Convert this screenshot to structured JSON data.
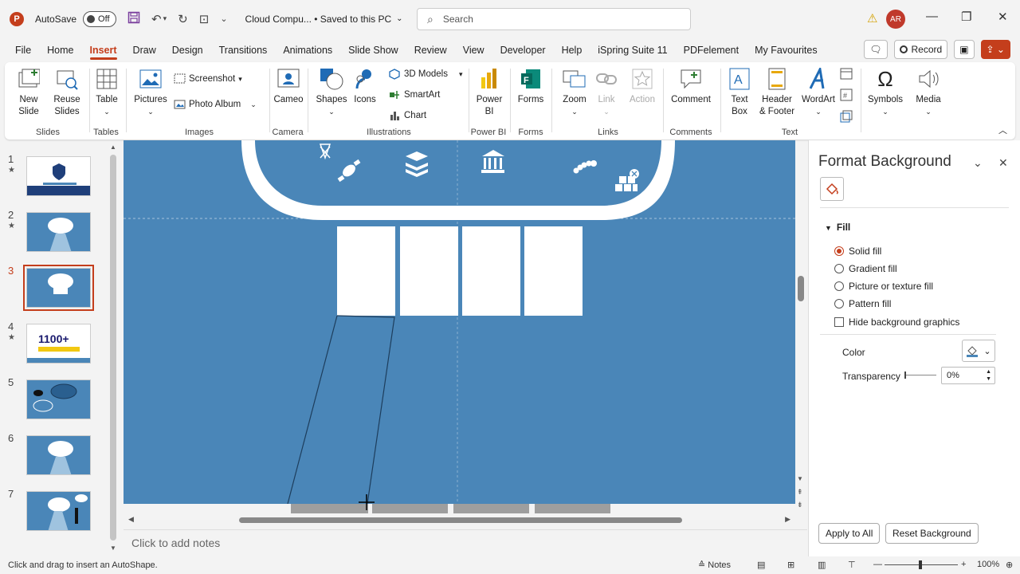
{
  "titlebar": {
    "autosave_label": "AutoSave",
    "autosave_state": "Off",
    "doc_title": "Cloud Compu... • Saved to this PC",
    "search_placeholder": "Search",
    "user_initials": "AR"
  },
  "menu": {
    "tabs": [
      "File",
      "Home",
      "Insert",
      "Draw",
      "Design",
      "Transitions",
      "Animations",
      "Slide Show",
      "Review",
      "View",
      "Developer",
      "Help",
      "iSpring Suite 11",
      "PDFelement",
      "My Favourites"
    ],
    "active": "Insert",
    "record_label": "Record"
  },
  "ribbon": {
    "slides": {
      "label": "Slides",
      "new_slide": "New\nSlide",
      "reuse_slides": "Reuse\nSlides"
    },
    "tables": {
      "label": "Tables",
      "table": "Table"
    },
    "images": {
      "label": "Images",
      "pictures": "Pictures",
      "screenshot": "Screenshot",
      "photo_album": "Photo Album"
    },
    "camera": {
      "label": "Camera",
      "cameo": "Cameo"
    },
    "illustrations": {
      "label": "Illustrations",
      "shapes": "Shapes",
      "icons": "Icons",
      "models_3d": "3D Models",
      "smartart": "SmartArt",
      "chart": "Chart"
    },
    "powerbi": {
      "label": "Power BI",
      "power_bi": "Power\nBI"
    },
    "forms": {
      "label": "Forms",
      "forms": "Forms"
    },
    "links": {
      "label": "Links",
      "zoom": "Zoom",
      "link": "Link",
      "action": "Action"
    },
    "comments": {
      "label": "Comments",
      "comment": "Comment"
    },
    "text": {
      "label": "Text",
      "text_box": "Text\nBox",
      "header_footer": "Header\n& Footer",
      "wordart": "WordArt"
    },
    "symbols": {
      "symbols": "Symbols"
    },
    "media": {
      "media": "Media"
    }
  },
  "thumbnails": [
    {
      "num": "1",
      "starred": true
    },
    {
      "num": "2",
      "starred": true
    },
    {
      "num": "3",
      "starred": false,
      "active": true
    },
    {
      "num": "4",
      "starred": true,
      "thumb_text": "1100+"
    },
    {
      "num": "5",
      "starred": false
    },
    {
      "num": "6",
      "starred": false
    },
    {
      "num": "7",
      "starred": false
    }
  ],
  "notes_placeholder": "Click to add notes",
  "format_pane": {
    "title": "Format Background",
    "section": "Fill",
    "options": [
      "Solid fill",
      "Gradient fill",
      "Picture or texture fill",
      "Pattern fill"
    ],
    "selected": "Solid fill",
    "hide_graphics": "Hide background graphics",
    "color_label": "Color",
    "transparency_label": "Transparency",
    "transparency_value": "0%",
    "apply_all": "Apply to All",
    "reset": "Reset Background"
  },
  "statusbar": {
    "message": "Click and drag to insert an AutoShape.",
    "notes": "Notes",
    "zoom": "100%"
  },
  "colors": {
    "accent": "#c43e1c",
    "slide_bg": "#4a86b8"
  }
}
